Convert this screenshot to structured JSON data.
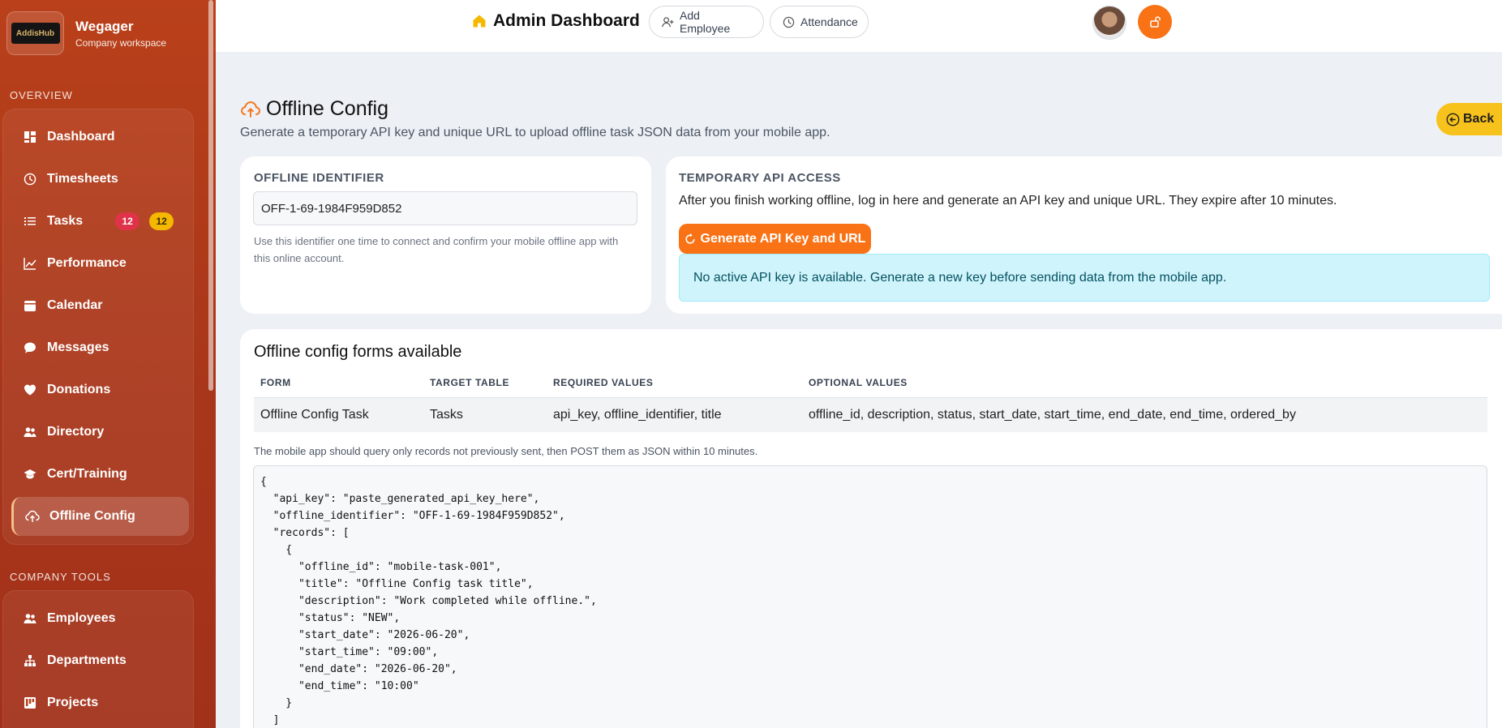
{
  "sidebar": {
    "brand_name": "Wegager",
    "brand_sub": "Company workspace",
    "logo_text": "AddisHub",
    "overview_label": "OVERVIEW",
    "tools_label": "COMPANY TOOLS",
    "items": [
      {
        "label": "Dashboard",
        "icon": "dashboard-icon"
      },
      {
        "label": "Timesheets",
        "icon": "clock-icon"
      },
      {
        "label": "Tasks",
        "icon": "list-icon",
        "badge_red": "12",
        "badge_yellow": "12"
      },
      {
        "label": "Performance",
        "icon": "chart-icon"
      },
      {
        "label": "Calendar",
        "icon": "calendar-icon"
      },
      {
        "label": "Messages",
        "icon": "chat-icon"
      },
      {
        "label": "Donations",
        "icon": "heart-icon"
      },
      {
        "label": "Directory",
        "icon": "people-icon"
      },
      {
        "label": "Cert/Training",
        "icon": "graduation-icon"
      },
      {
        "label": "Offline Config",
        "icon": "cloud-upload-icon",
        "active": true
      }
    ],
    "tools": [
      {
        "label": "Employees",
        "icon": "people-icon"
      },
      {
        "label": "Departments",
        "icon": "org-icon"
      },
      {
        "label": "Projects",
        "icon": "kanban-icon"
      }
    ]
  },
  "topbar": {
    "title": "Admin Dashboard",
    "add_employee": "Add Employee",
    "attendance": "Attendance"
  },
  "page": {
    "title": "Offline Config",
    "subtitle": "Generate a temporary API key and unique URL to upload offline task JSON data from your mobile app.",
    "back": "Back"
  },
  "identifier_card": {
    "label": "OFFLINE IDENTIFIER",
    "value": "OFF-1-69-1984F959D852",
    "hint": "Use this identifier one time to connect and confirm your mobile offline app with this online account."
  },
  "api_card": {
    "label": "TEMPORARY API ACCESS",
    "description": "After you finish working offline, log in here and generate an API key and unique URL. They expire after 10 minutes.",
    "button": "Generate API Key and URL",
    "info": "No active API key is available. Generate a new key before sending data from the mobile app."
  },
  "forms_card": {
    "title": "Offline config forms available",
    "headers": [
      "FORM",
      "TARGET TABLE",
      "REQUIRED VALUES",
      "OPTIONAL VALUES"
    ],
    "row": [
      "Offline Config Task",
      "Tasks",
      "api_key, offline_identifier, title",
      "offline_id, description, status, start_date, start_time, end_date, end_time, ordered_by"
    ],
    "note": "The mobile app should query only records not previously sent, then POST them as JSON within 10 minutes.",
    "json": "{\n  \"api_key\": \"paste_generated_api_key_here\",\n  \"offline_identifier\": \"OFF-1-69-1984F959D852\",\n  \"records\": [\n    {\n      \"offline_id\": \"mobile-task-001\",\n      \"title\": \"Offline Config task title\",\n      \"description\": \"Work completed while offline.\",\n      \"status\": \"NEW\",\n      \"start_date\": \"2026-06-20\",\n      \"start_time\": \"09:00\",\n      \"end_date\": \"2026-06-20\",\n      \"end_time\": \"10:00\"\n    }\n  ]\n}"
  },
  "colors": {
    "sidebar": "#b9401a",
    "accent": "#f97316",
    "back": "#f8c21c",
    "info_bg": "#cff4fc"
  }
}
